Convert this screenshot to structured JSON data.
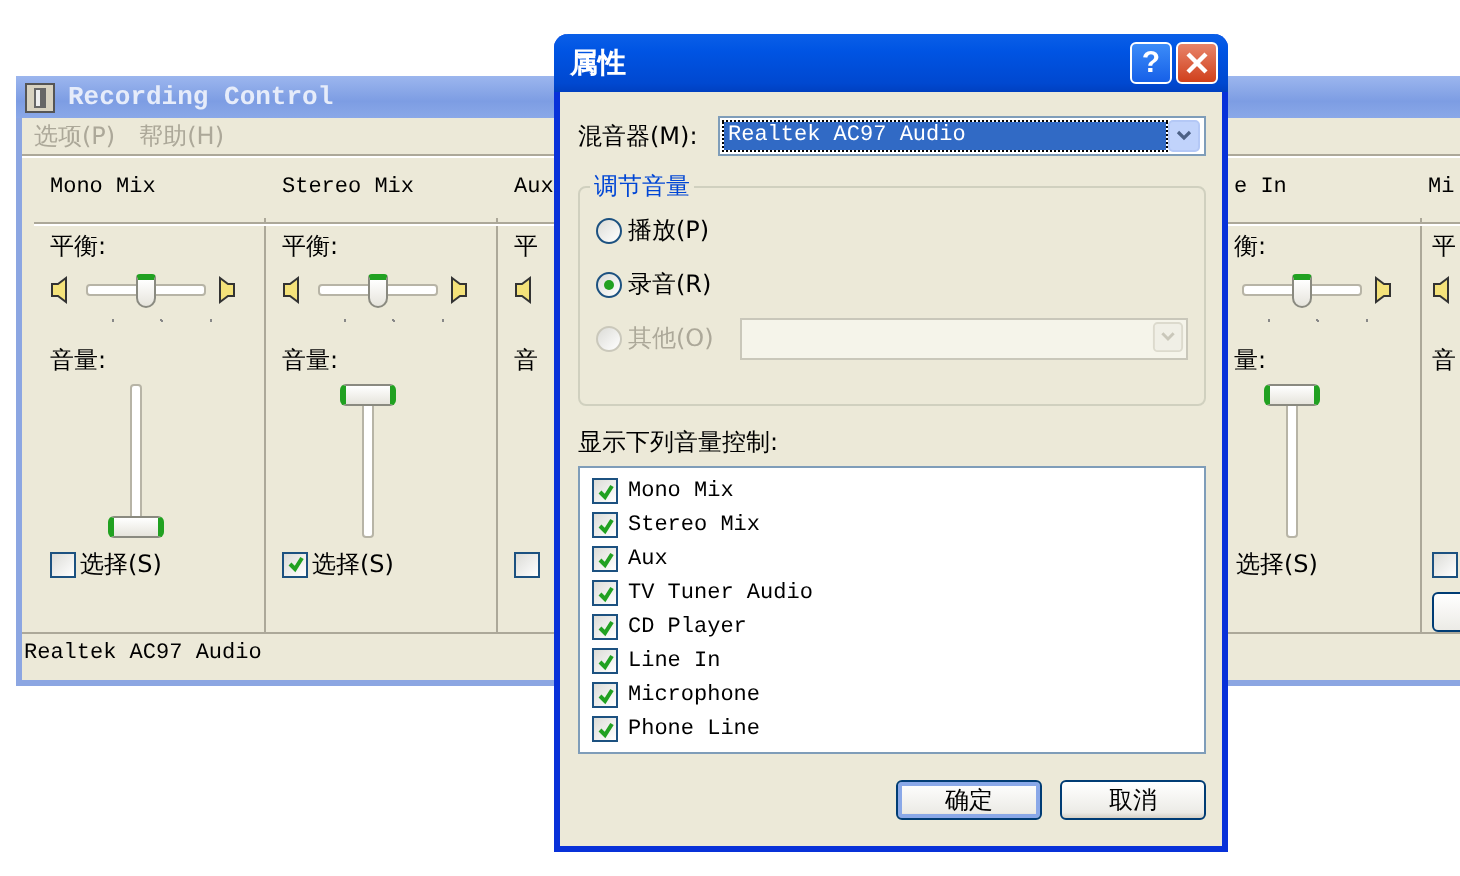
{
  "back_window": {
    "title": "Recording Control",
    "menu": [
      "选项(P)",
      "帮助(H)"
    ],
    "channels": [
      {
        "kind": "full",
        "name": "Mono Mix",
        "balance_label": "平衡:",
        "balance": {
          "level": 0.5
        },
        "volume_label": "音量:",
        "volume": {
          "level": 0
        },
        "select": {
          "label": "选择(S)",
          "checked": false
        }
      },
      {
        "kind": "full",
        "name": "Stereo Mix",
        "balance_label": "平衡:",
        "balance": {
          "level": 0.5
        },
        "volume_label": "音量:",
        "volume": {
          "level": 1
        },
        "select": {
          "label": "选择(S)",
          "checked": true
        }
      },
      {
        "kind": "cut_right",
        "name": "Aux",
        "balance_label": "平",
        "volume_label": "音",
        "select": {
          "checked": false
        }
      },
      {
        "kind": "cut_left",
        "name": "e In",
        "balance_label": "衡:",
        "balance": {
          "level": 0.5
        },
        "volume_label": "量:",
        "volume": {
          "level": 1
        },
        "select": {
          "label": "选择(S)"
        }
      },
      {
        "kind": "cut_right",
        "name": "Mi",
        "balance_label": "平",
        "volume_label": "音",
        "select": {
          "checked": false
        },
        "has_button": true
      }
    ],
    "status_bar": "Realtek AC97 Audio"
  },
  "dialog": {
    "title": "属性",
    "help_button": "?",
    "mixer_label": "混音器(M):",
    "mixer_value": "Realtek AC97 Audio",
    "group_title": "调节音量",
    "modes": [
      {
        "label": "播放(P)",
        "selected": false,
        "disabled": false
      },
      {
        "label": "录音(R)",
        "selected": true,
        "disabled": false
      },
      {
        "label": "其他(O)",
        "selected": false,
        "disabled": true
      }
    ],
    "list_label": "显示下列音量控制:",
    "controls": [
      {
        "label": "Mono Mix",
        "checked": true
      },
      {
        "label": "Stereo Mix",
        "checked": true
      },
      {
        "label": "Aux",
        "checked": true
      },
      {
        "label": "TV Tuner Audio",
        "checked": true
      },
      {
        "label": "CD Player",
        "checked": true
      },
      {
        "label": "Line In",
        "checked": true
      },
      {
        "label": "Microphone",
        "checked": true
      },
      {
        "label": "Phone Line",
        "checked": true
      }
    ],
    "buttons": [
      {
        "label": "确定",
        "default": true
      },
      {
        "label": "取消",
        "default": false
      }
    ]
  }
}
